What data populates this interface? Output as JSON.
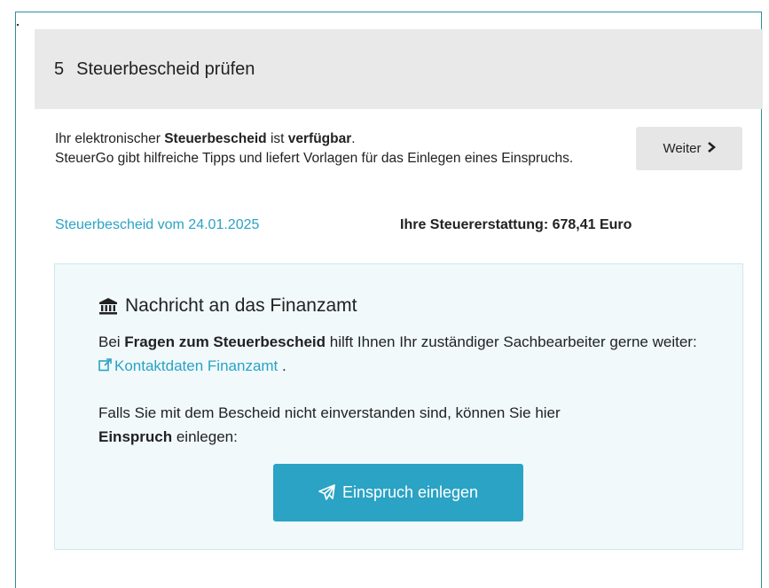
{
  "step": {
    "number": "5",
    "title": "Steuerbescheid prüfen"
  },
  "intro": {
    "line1_prefix": "Ihr elektronischer ",
    "line1_bold1": "Steuerbescheid",
    "line1_mid": " ist ",
    "line1_bold2": "verfügbar",
    "line1_suffix": ".",
    "line2": "SteuerGo gibt hilfreiche Tipps und liefert Vorlagen für das Einlegen eines Einspruchs."
  },
  "weiter_button": {
    "label": "Weiter"
  },
  "bescheid_link": "Steuerbescheid vom 24.01.2025",
  "refund": "Ihre Steuererstattung: 678,41 Euro",
  "panel": {
    "title": "Nachricht an das Finanzamt",
    "p1_prefix": "Bei ",
    "p1_bold": "Fragen zum Steuerbescheid",
    "p1_mid": " hilft Ihnen Ihr zuständiger Sachbearbeiter gerne weiter: ",
    "p1_link": "Kontaktdaten Finanzamt",
    "p1_suffix": " .",
    "p2_prefix": "Falls Sie mit dem Bescheid nicht einverstanden sind, können Sie hier ",
    "p2_bold": "Einspruch",
    "p2_suffix": " einlegen:",
    "button_label": "Einspruch einlegen"
  },
  "colors": {
    "accent": "#2aa3c4",
    "header_bg": "#e9e9e9",
    "panel_bg": "#f1f9fb",
    "frame": "#2d8f9a"
  },
  "icons": {
    "title_icon": "bank-icon",
    "link_icon": "external-link-icon",
    "button_icon": "paper-plane-icon",
    "weiter_icon": "chevron-right-icon"
  }
}
